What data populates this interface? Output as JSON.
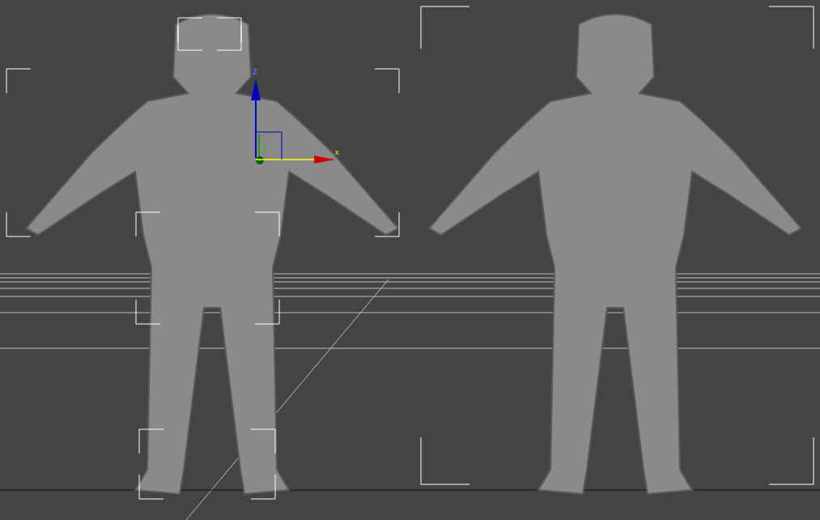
{
  "viewport": {
    "gizmo": {
      "axes": [
        {
          "kind": "z",
          "label": "z"
        },
        {
          "kind": "y",
          "label": "y"
        },
        {
          "kind": "x",
          "label": "x"
        }
      ]
    }
  }
}
